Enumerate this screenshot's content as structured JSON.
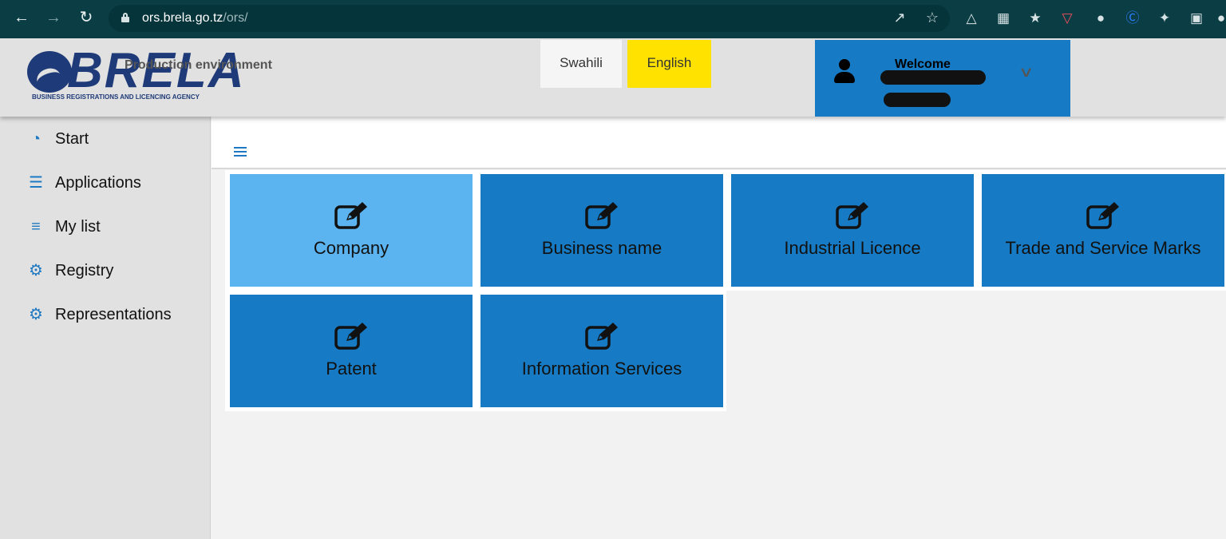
{
  "browser": {
    "url_host": "ors.brela.go.tz",
    "url_path": "/ors/"
  },
  "header": {
    "logo_text": "BRELA",
    "logo_subtitle": "BUSINESS REGISTRATIONS AND LICENCING AGENCY",
    "environment": "Production environment",
    "lang_swahili": "Swahili",
    "lang_english": "English",
    "welcome": "Welcome"
  },
  "sidebar": {
    "items": [
      {
        "label": "Start",
        "icon": "dashboard-icon"
      },
      {
        "label": "Applications",
        "icon": "server-icon"
      },
      {
        "label": "My list",
        "icon": "list-icon"
      },
      {
        "label": "Registry",
        "icon": "gear-icon"
      },
      {
        "label": "Representations",
        "icon": "gear-icon"
      }
    ]
  },
  "tiles": [
    {
      "label": "Company",
      "active": true
    },
    {
      "label": "Business name",
      "active": false
    },
    {
      "label": "Industrial Licence",
      "active": false
    },
    {
      "label": "Trade and Service Marks",
      "active": false
    },
    {
      "label": "Patent",
      "active": false
    },
    {
      "label": "Information Services",
      "active": false
    }
  ],
  "colors": {
    "brand_blue": "#167bc4",
    "active_tile": "#5bb3ef",
    "english_highlight": "#ffe200",
    "chrome_bg": "#0b3d45"
  }
}
